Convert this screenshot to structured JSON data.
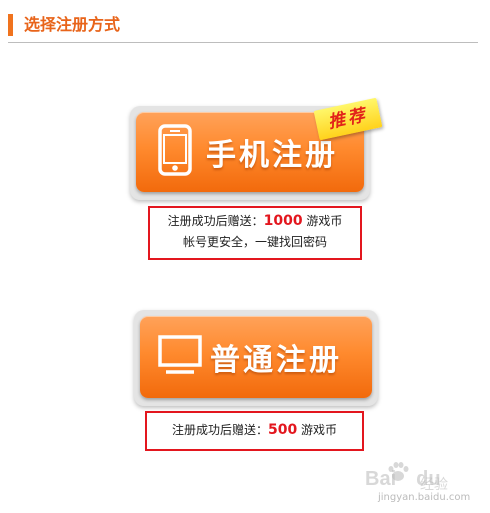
{
  "header": {
    "title": "选择注册方式"
  },
  "mobile_register": {
    "label": "手机注册",
    "badge": "推荐",
    "info_prefix": "注册成功后赠送：",
    "info_amount": "1000",
    "info_suffix": " 游戏币",
    "info_line2": "帐号更安全，一键找回密码"
  },
  "normal_register": {
    "label": "普通注册",
    "info_prefix": "注册成功后赠送：",
    "info_amount": "500",
    "info_suffix": " 游戏币"
  },
  "watermark": {
    "brand": "Bai",
    "brand_suffix": "du",
    "sub": "经验",
    "url": "jingyan.baidu.com"
  },
  "colors": {
    "accent": "#f0731e",
    "button_orange": "#ff8a2e",
    "highlight_red": "#e3161e",
    "badge_yellow": "#ffd21c"
  }
}
